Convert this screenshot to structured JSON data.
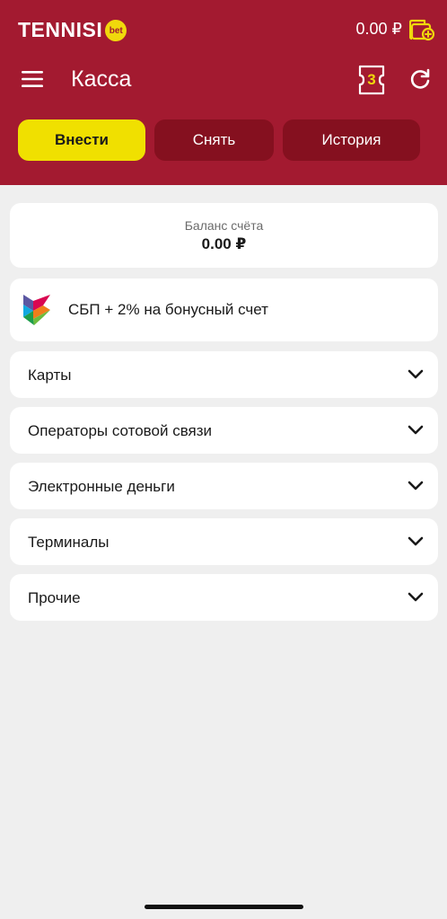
{
  "brand": {
    "name": "TENNISI",
    "badge": "bet"
  },
  "header": {
    "balance": "0.00 ₽",
    "title": "Касса",
    "ticket_count": "3"
  },
  "tabs": [
    {
      "label": "Внести",
      "active": true
    },
    {
      "label": "Снять",
      "active": false
    },
    {
      "label": "История",
      "active": false
    }
  ],
  "account": {
    "label": "Баланс счёта",
    "value": "0.00 ₽"
  },
  "sbp": {
    "label": "СБП + 2% на бонусный счет"
  },
  "methods": [
    {
      "label": "Карты"
    },
    {
      "label": "Операторы сотовой связи"
    },
    {
      "label": "Электронные деньги"
    },
    {
      "label": "Терминалы"
    },
    {
      "label": "Прочие"
    }
  ],
  "colors": {
    "header_bg": "#a31a30",
    "tab_active_bg": "#f0e000",
    "tab_inactive_bg": "#85101f",
    "accent_yellow": "#f0d80c",
    "page_bg": "#efefef"
  },
  "icons": [
    "menu-icon",
    "wallet-icon",
    "ticket-icon",
    "refresh-icon",
    "sbp-logo-icon",
    "chevron-down-icon"
  ]
}
